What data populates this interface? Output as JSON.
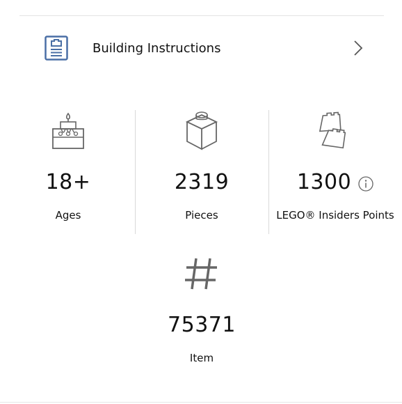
{
  "instructions": {
    "label": "Building Instructions",
    "icon": "instructions-booklet-icon",
    "chevron": "chevron-right-icon",
    "accent": "#4a6fa5"
  },
  "stats": [
    {
      "key": "ages",
      "icon": "birthday-cake-icon",
      "value": "18+",
      "label": "Ages"
    },
    {
      "key": "pieces",
      "icon": "lego-brick-icon",
      "value": "2319",
      "label": "Pieces"
    },
    {
      "key": "points",
      "icon": "insiders-points-icon",
      "value": "1300",
      "label": "LEGO® Insiders Points",
      "info_icon": "info-icon"
    },
    {
      "key": "item",
      "icon": "hash-icon",
      "value": "75371",
      "label": "Item"
    }
  ]
}
